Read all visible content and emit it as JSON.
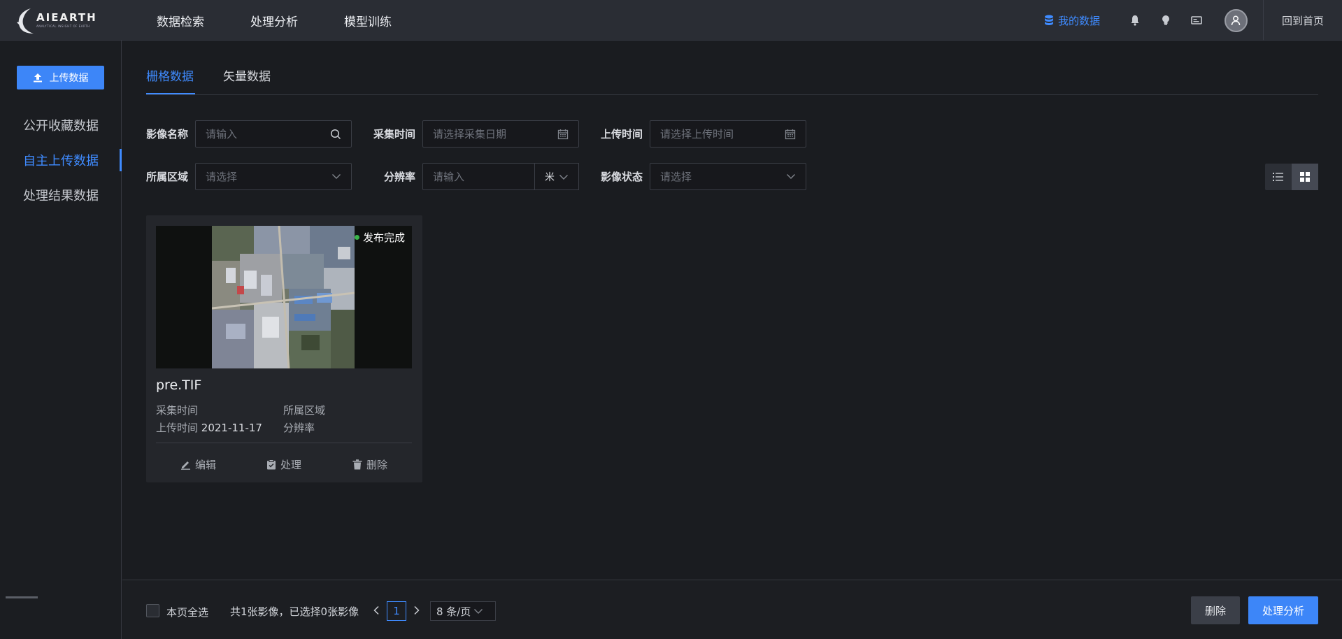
{
  "header": {
    "logo_text": "AIEARTH",
    "logo_subtext": "ANALYTICAL INSIGHT OF EARTH",
    "nav": [
      "数据检索",
      "处理分析",
      "模型训练"
    ],
    "my_data_label": "我的数据",
    "back_home_label": "回到首页",
    "accent_color": "#3f8bff"
  },
  "sidebar": {
    "upload_label": "上传数据",
    "items": [
      {
        "label": "公开收藏数据"
      },
      {
        "label": "自主上传数据"
      },
      {
        "label": "处理结果数据"
      }
    ],
    "active_item": "自主上传数据"
  },
  "tabs": [
    {
      "label": "栅格数据"
    },
    {
      "label": "矢量数据"
    }
  ],
  "active_tab": "栅格数据",
  "filters": {
    "image_name": {
      "label": "影像名称",
      "placeholder": "请输入"
    },
    "capture_time": {
      "label": "采集时间",
      "placeholder": "请选择采集日期"
    },
    "upload_time": {
      "label": "上传时间",
      "placeholder": "请选择上传时间"
    },
    "region": {
      "label": "所属区域",
      "placeholder": "请选择"
    },
    "resolution": {
      "label": "分辨率",
      "placeholder": "请输入",
      "unit": "米"
    },
    "status": {
      "label": "影像状态",
      "placeholder": "请选择"
    }
  },
  "view_mode": "grid",
  "cards": [
    {
      "name": "pre.TIF",
      "status": "发布完成",
      "status_color": "#3ab54a",
      "capture_time_label": "采集时间",
      "capture_time": "",
      "upload_time_label": "上传时间",
      "upload_time": "2021-11-17",
      "region_label": "所属区域",
      "region": "",
      "resolution_label": "分辨率",
      "resolution": "",
      "actions": {
        "edit": "编辑",
        "process": "处理",
        "delete": "删除"
      }
    }
  ],
  "footer": {
    "select_all_label": "本页全选",
    "summary": "共1张影像，已选择0张影像",
    "current_page": "1",
    "page_size": "8 条/页",
    "delete_label": "删除",
    "process_label": "处理分析"
  }
}
